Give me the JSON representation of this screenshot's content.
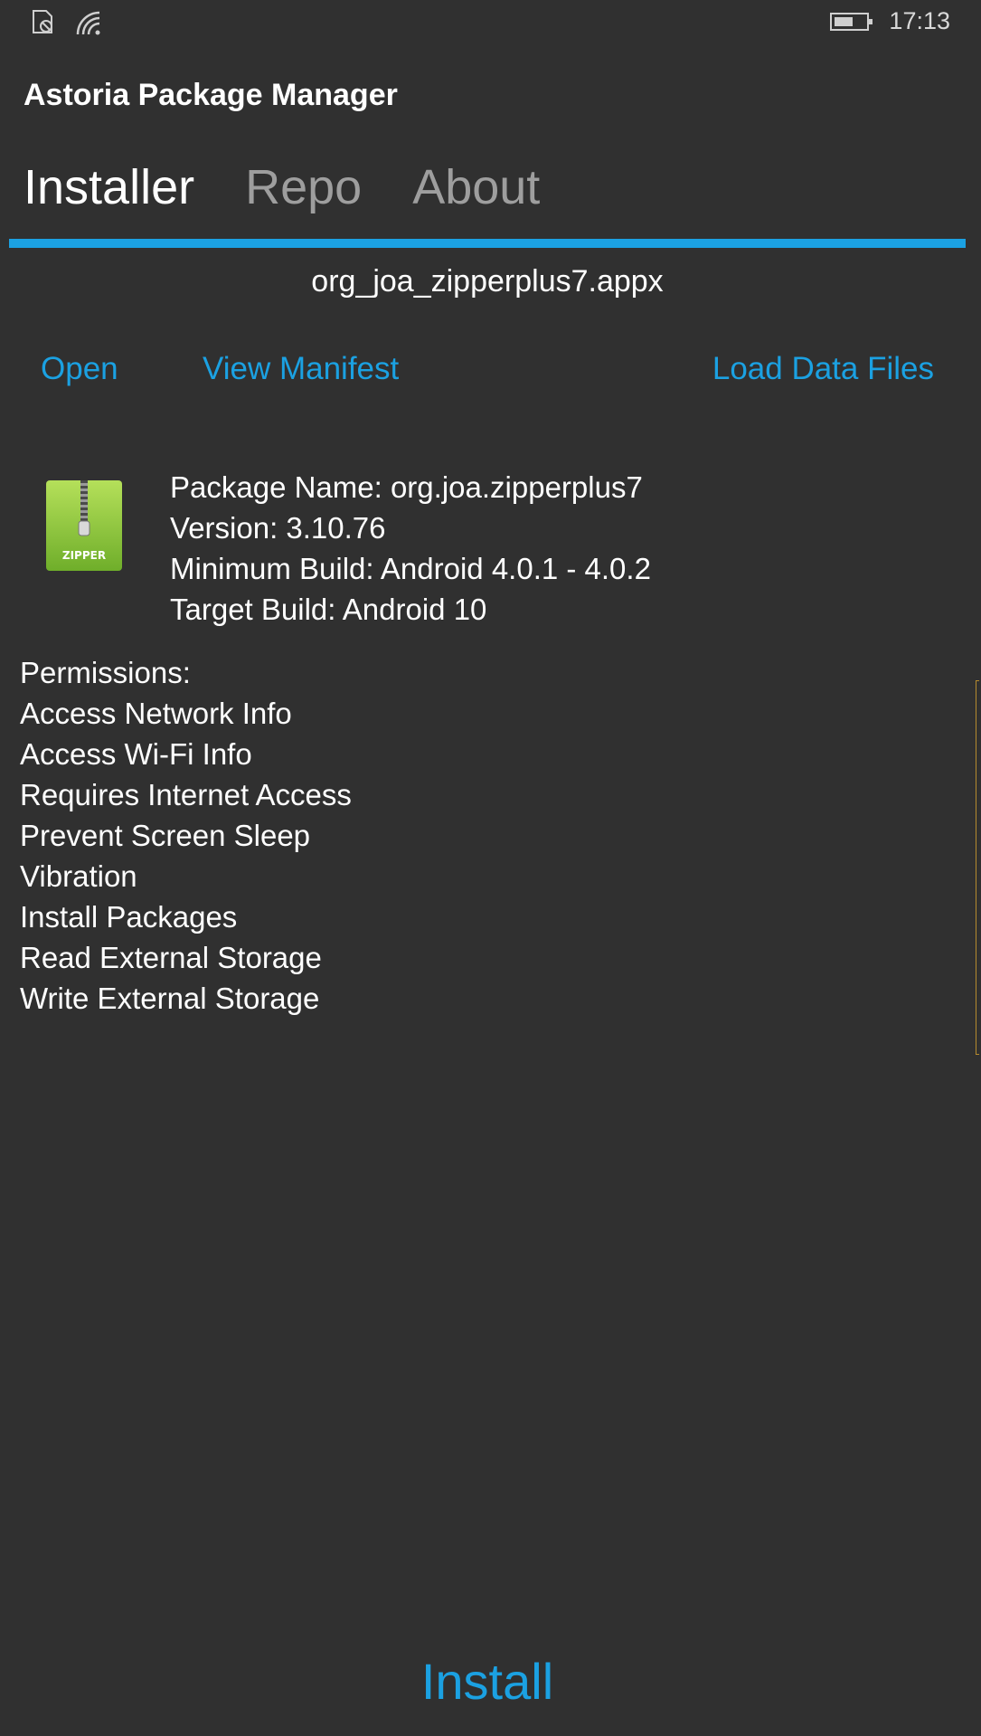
{
  "status_bar": {
    "time": "17:13",
    "icons": [
      "sim-icon",
      "wifi-icon",
      "battery-icon"
    ]
  },
  "app": {
    "title": "Astoria Package Manager"
  },
  "tabs": [
    {
      "label": "Installer",
      "active": true
    },
    {
      "label": "Repo",
      "active": false
    },
    {
      "label": "About",
      "active": false
    }
  ],
  "file_name": "org_joa_zipperplus7.appx",
  "actions": {
    "open": "Open",
    "view_manifest": "View Manifest",
    "load_data_files": "Load Data Files"
  },
  "package": {
    "icon_label": "ZIPPER",
    "name": "Package Name: org.joa.zipperplus7",
    "version": "Version: 3.10.76",
    "min_build": "Minimum Build: Android 4.0.1 - 4.0.2",
    "target_build": "Target Build: Android 10"
  },
  "permissions": {
    "heading": "Permissions:",
    "items": [
      "Access Network Info",
      "Access Wi-Fi Info",
      "Requires Internet Access",
      "Prevent Screen Sleep",
      "Vibration",
      "Install Packages",
      "Read External Storage",
      "Write External Storage"
    ]
  },
  "install_label": "Install",
  "colors": {
    "background": "#303030",
    "accent": "#1ba1e2",
    "text": "#ffffff",
    "inactive_tab": "#9e9e9e",
    "zipper_green": "#8cc63f"
  }
}
